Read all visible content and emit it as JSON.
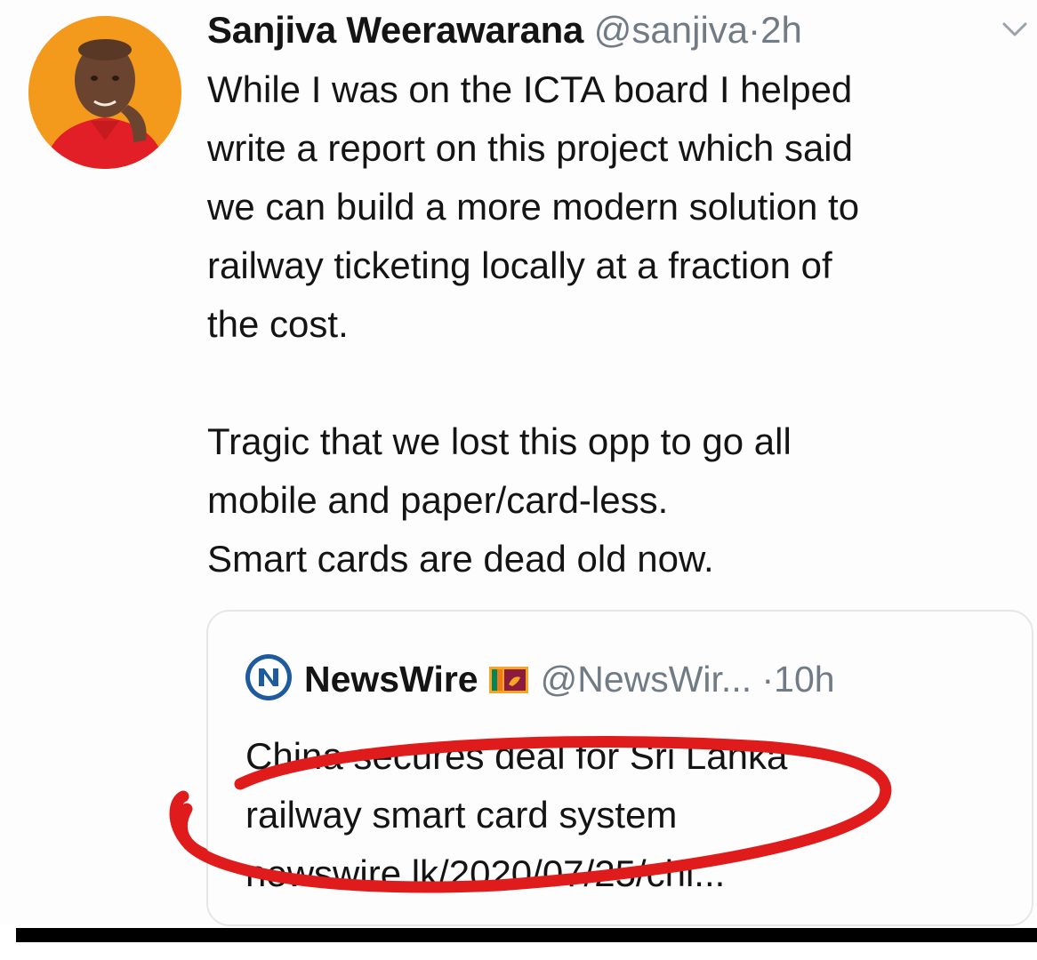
{
  "tweet": {
    "author_name": "Sanjiva Weerawarana",
    "handle": "@sanjiva",
    "separator": "·",
    "time": "2h",
    "menu_icon": "chevron-down-icon",
    "body_lines": [
      "While I was on the ICTA board I helped",
      "write a report on this project which said",
      "we can build a more modern solution to",
      "railway ticketing locally at a fraction of",
      "the cost."
    ],
    "body_lines_2": [
      "Tragic that we lost this opp to go all",
      "mobile and paper/card-less.",
      "Smart cards are dead old now."
    ]
  },
  "quoted": {
    "logo_icon": "newswire-logo-icon",
    "name": "NewsWire",
    "flag_icon": "sri-lanka-flag-icon",
    "handle": "@NewsWir...",
    "separator": "·",
    "time": "10h",
    "text_lines": [
      "China secures deal for Sri Lanka",
      "railway smart card system",
      "newswire.lk/2020/07/25/chi..."
    ]
  },
  "colors": {
    "text": "#141414",
    "muted": "#707b85",
    "annotation": "#e01b1b",
    "avatar_bg": "#f39a1c",
    "border": "#e3e7ea"
  }
}
